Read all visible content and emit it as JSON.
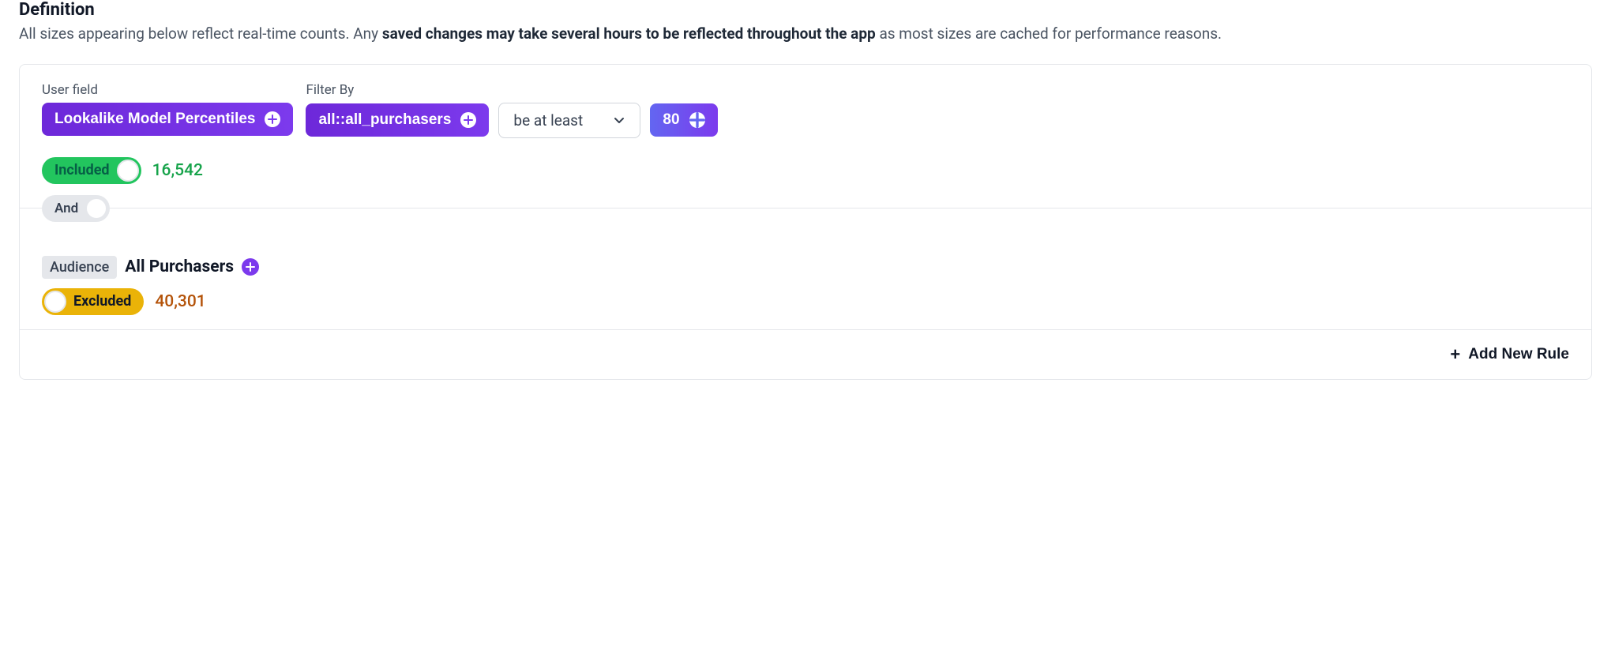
{
  "header": {
    "title": "Definition",
    "desc_prefix": "All sizes appearing below reflect real-time counts. Any ",
    "desc_bold": "saved changes may take several hours to be reflected throughout the app",
    "desc_suffix": " as most sizes are cached for performance reasons."
  },
  "rule1": {
    "user_field_label": "User field",
    "filter_by_label": "Filter By",
    "user_field_chip": "Lookalike Model Percentiles",
    "filter_chip": "all::all_purchasers",
    "comparator": "be at least",
    "value": "80",
    "toggle_label": "Included",
    "count": "16,542"
  },
  "connector": {
    "label": "And"
  },
  "rule2": {
    "tag_label": "Audience",
    "audience_name": "All Purchasers",
    "toggle_label": "Excluded",
    "count": "40,301"
  },
  "footer": {
    "add_rule_label": "Add New Rule"
  }
}
